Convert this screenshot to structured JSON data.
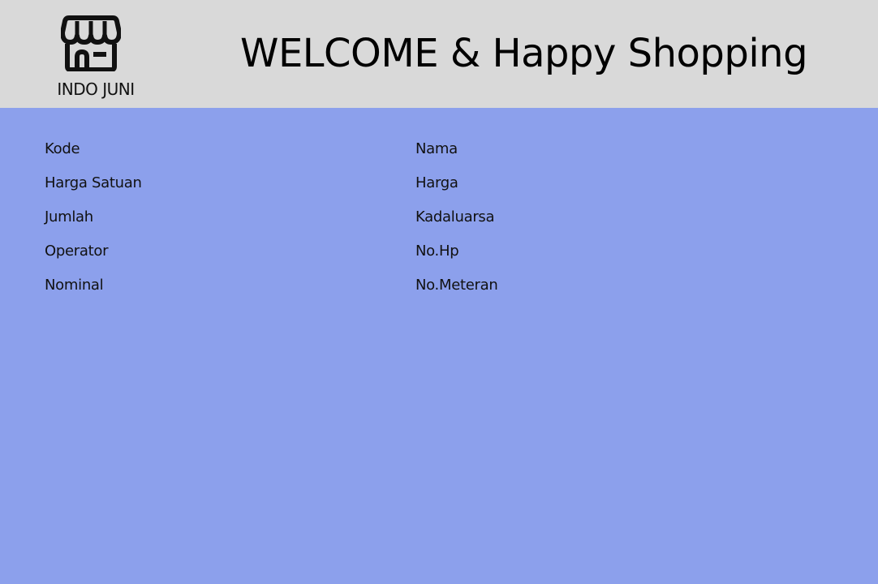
{
  "header": {
    "brand": "INDO JUNI",
    "logo_icon": "store-icon",
    "title": "WELCOME & Happy Shopping",
    "background": "#d9d9d9"
  },
  "main": {
    "background": "#8ca0ec",
    "fields_left": [
      "Kode",
      "Harga Satuan",
      "Jumlah",
      "Operator",
      "Nominal"
    ],
    "fields_right": [
      "Nama",
      "Harga",
      "Kadaluarsa",
      "No.Hp",
      "No.Meteran"
    ]
  }
}
